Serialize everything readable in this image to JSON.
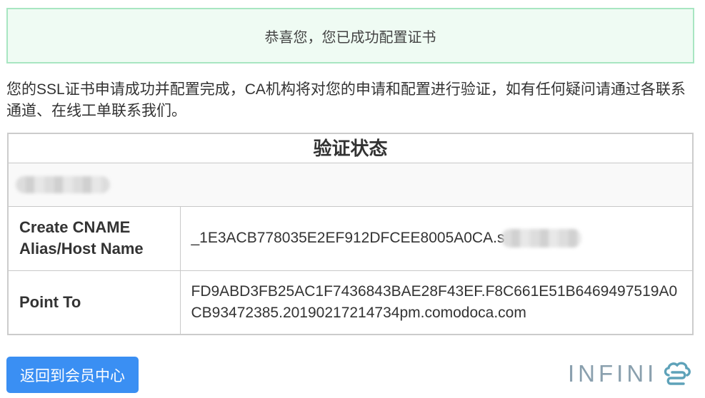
{
  "alert": {
    "message": "恭喜您，您已成功配置证书"
  },
  "intro": "您的SSL证书申请成功并配置完成，CA机构将对您的申请和配置进行验证，如有任何疑问请通过各联系通道、在线工单联系我们。",
  "status_table": {
    "title": "验证状态",
    "rows": [
      {
        "label": "Create CNAME Alias/Host Name",
        "value": "_1E3ACB778035E2EF912DFCEE8005A0CA.s"
      },
      {
        "label": "Point To",
        "value": "FD9ABD3FB25AC1F7436843BAE28F43EF.F8C661E51B6469497519A0CB93472385.20190217214734pm.comodoca.com"
      }
    ]
  },
  "back_button": {
    "label": "返回到会员中心"
  },
  "logo": {
    "text": "INFINI",
    "icon": "cloud-icon"
  },
  "colors": {
    "accent": "#3a8ff3",
    "success_background": "#effbf3",
    "success_border": "#a8e6c2",
    "table_border": "#cccccc",
    "logo_text": "#8aa0ae",
    "logo_icon": "#5ea2b9"
  }
}
